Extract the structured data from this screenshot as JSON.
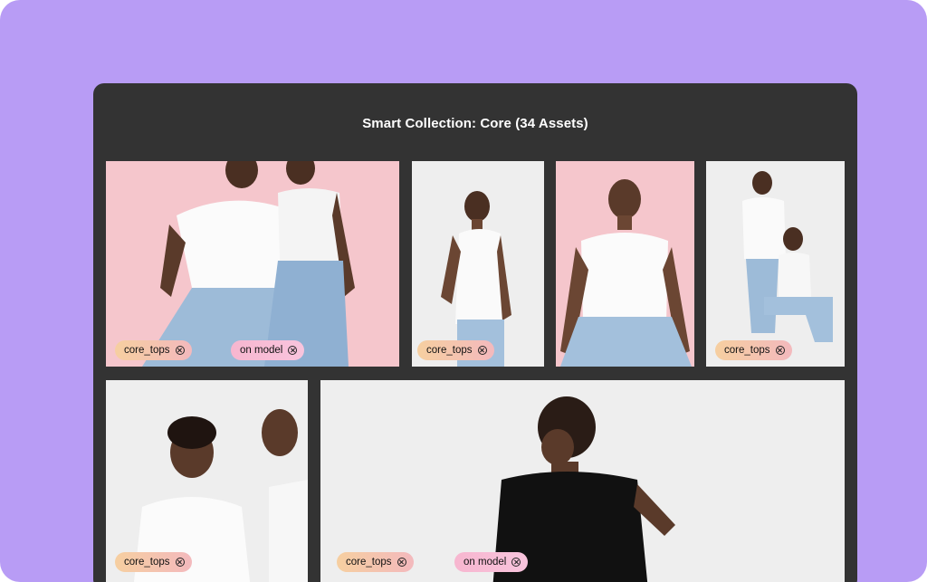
{
  "collection": {
    "title": "Smart Collection: Core (34 Assets)"
  },
  "tags": {
    "core_tops": "core_tops",
    "on_model": "on model"
  },
  "colors": {
    "background": "#b89cf5",
    "panel": "#333333",
    "pink_backdrop": "#f5c6cc",
    "grey_backdrop": "#eeeeee"
  },
  "assets": [
    {
      "tags": [
        "core_tops",
        "on model"
      ]
    },
    {
      "tags": [
        "core_tops"
      ]
    },
    {
      "tags": []
    },
    {
      "tags": [
        "core_tops"
      ]
    },
    {
      "tags": [
        "core_tops"
      ]
    },
    {
      "tags": [
        "core_tops",
        "on model"
      ]
    }
  ]
}
